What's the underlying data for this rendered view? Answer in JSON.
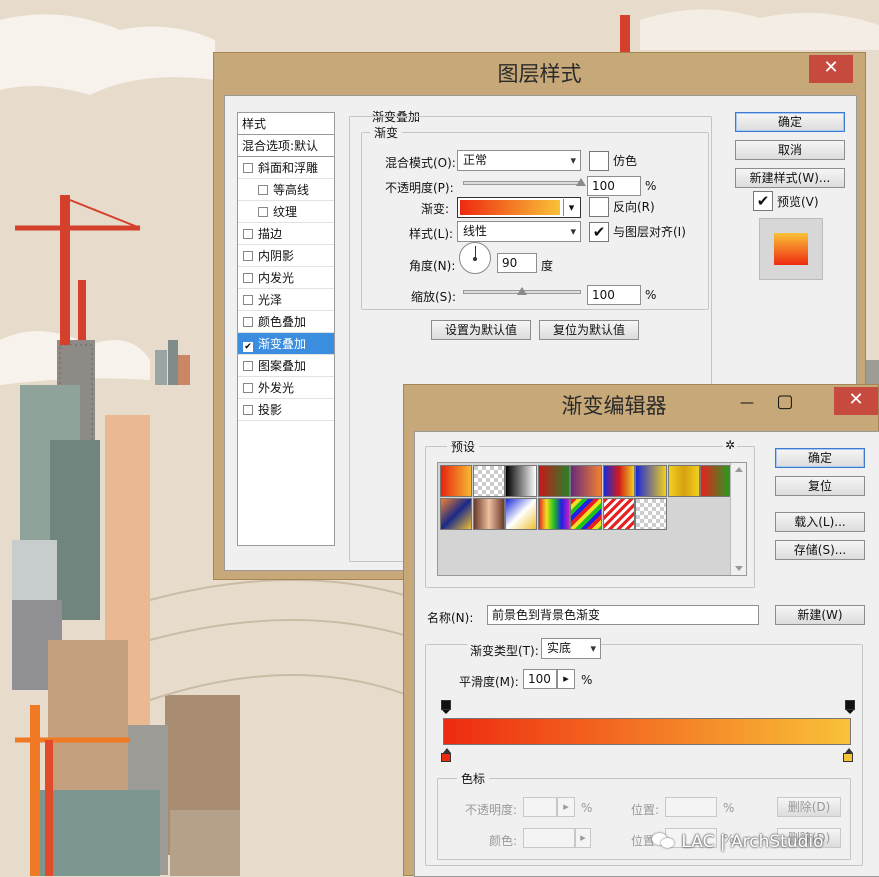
{
  "layer_style": {
    "title": "图层样式",
    "close_glyph": "✕",
    "style_list": {
      "header": "样式",
      "blend_options": "混合选项:默认",
      "items": [
        {
          "label": "斜面和浮雕",
          "checked": false,
          "indent": false
        },
        {
          "label": "等高线",
          "checked": false,
          "indent": true
        },
        {
          "label": "纹理",
          "checked": false,
          "indent": true
        },
        {
          "label": "描边",
          "checked": false,
          "indent": false
        },
        {
          "label": "内阴影",
          "checked": false,
          "indent": false
        },
        {
          "label": "内发光",
          "checked": false,
          "indent": false
        },
        {
          "label": "光泽",
          "checked": false,
          "indent": false
        },
        {
          "label": "颜色叠加",
          "checked": false,
          "indent": false
        },
        {
          "label": "渐变叠加",
          "checked": true,
          "indent": false
        },
        {
          "label": "图案叠加",
          "checked": false,
          "indent": false
        },
        {
          "label": "外发光",
          "checked": false,
          "indent": false
        },
        {
          "label": "投影",
          "checked": false,
          "indent": false
        }
      ]
    },
    "section_title": "渐变叠加",
    "group_title": "渐变",
    "blend_mode_label": "混合模式(O):",
    "blend_mode_value": "正常",
    "dither_label": "仿色",
    "dither_checked": false,
    "opacity_label": "不透明度(P):",
    "opacity_value": "100",
    "opacity_percent": 1.0,
    "percent_sign": "%",
    "gradient_label": "渐变:",
    "reverse_label": "反向(R)",
    "reverse_checked": false,
    "style_label": "样式(L):",
    "style_value": "线性",
    "align_label": "与图层对齐(I)",
    "align_checked": true,
    "angle_label": "角度(N):",
    "angle_value": "90",
    "degree_sign": "度",
    "scale_label": "缩放(S):",
    "scale_value": "100",
    "scale_percent": 0.5,
    "set_default_button": "设置为默认值",
    "reset_default_button": "复位为默认值",
    "ok_button": "确定",
    "cancel_button": "取消",
    "new_style_button": "新建样式(W)...",
    "preview_label": "预览(V)",
    "preview_checked": true,
    "check_glyph": "✔",
    "chevron_glyph": "▾"
  },
  "gradient_editor": {
    "title": "渐变编辑器",
    "minimize_glyph": "—",
    "maximize_glyph": "▢",
    "close_glyph": "✕",
    "presets_label": "预设",
    "gear_glyph": "✲",
    "ok_button": "确定",
    "reset_button": "复位",
    "load_button": "载入(L)...",
    "save_button": "存储(S)...",
    "name_label": "名称(N):",
    "name_value": "前景色到背景色渐变",
    "new_button": "新建(W)",
    "type_label": "渐变类型(T):",
    "type_value": "实底",
    "smoothness_label": "平滑度(M):",
    "smoothness_value": "100",
    "percent_sign": "%",
    "arrow_glyph": "▸",
    "color_stops_title": "色标",
    "stop_opacity_label": "不透明度:",
    "stop_location_label": "位置:",
    "stop_delete_button": "删除(D)",
    "stop_color_label": "颜色:",
    "stop_location_label_2": "位置:",
    "stop_delete_button_2": "删除(D)",
    "gradient_start_color": "#ee2a10",
    "gradient_end_color": "#f9c238"
  },
  "watermark": "LAC | ArchStudio",
  "colors": {
    "window_frame": "#c7a878",
    "dialog_bg": "#f0f0f0",
    "selection_blue": "#3b8de0",
    "close_red": "#c74a3e"
  }
}
